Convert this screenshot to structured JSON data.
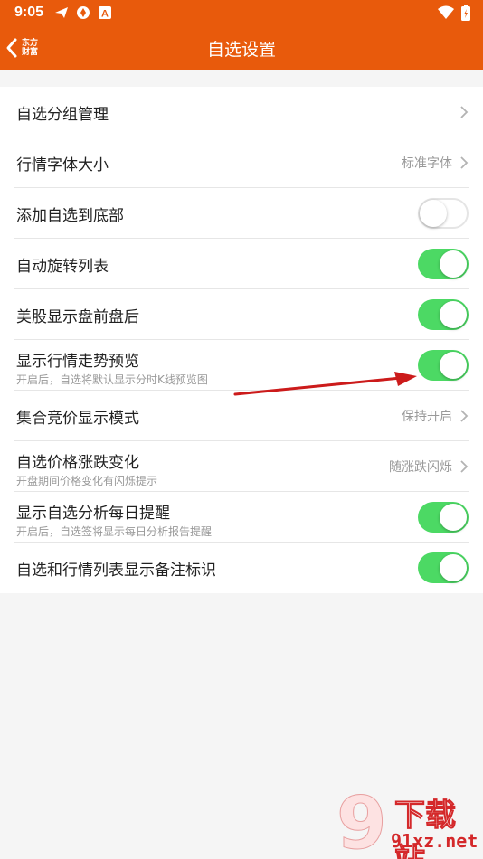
{
  "status": {
    "time": "9:05"
  },
  "header": {
    "brand_line1": "东方",
    "brand_line2": "财富",
    "title": "自选设置"
  },
  "rows": [
    {
      "label": "自选分组管理",
      "type": "link",
      "value": ""
    },
    {
      "label": "行情字体大小",
      "type": "link",
      "value": "标准字体"
    },
    {
      "label": "添加自选到底部",
      "type": "toggle",
      "on": false
    },
    {
      "label": "自动旋转列表",
      "type": "toggle",
      "on": true
    },
    {
      "label": "美股显示盘前盘后",
      "type": "toggle",
      "on": true
    },
    {
      "label": "显示行情走势预览",
      "sub": "开启后，自选将默认显示分时K线预览图",
      "type": "toggle",
      "on": true
    },
    {
      "label": "集合竞价显示模式",
      "type": "link",
      "value": "保持开启"
    },
    {
      "label": "自选价格涨跌变化",
      "sub": "开盘期间价格变化有闪烁提示",
      "type": "link",
      "value": "随涨跌闪烁"
    },
    {
      "label": "显示自选分析每日提醒",
      "sub": "开启后，自选签将显示每日分析报告提醒",
      "type": "toggle",
      "on": true
    },
    {
      "label": "自选和行情列表显示备注标识",
      "type": "toggle",
      "on": true
    }
  ],
  "watermark": {
    "text": "下载站",
    "url": "91xz.net",
    "logo_text": "9"
  },
  "colors": {
    "header": "#e85a0c",
    "toggle_on": "#4cd964",
    "annotation_arrow": "#cc1b1b"
  },
  "icons": {
    "back": "chevron-left-icon",
    "chevron": "chevron-right-icon"
  }
}
